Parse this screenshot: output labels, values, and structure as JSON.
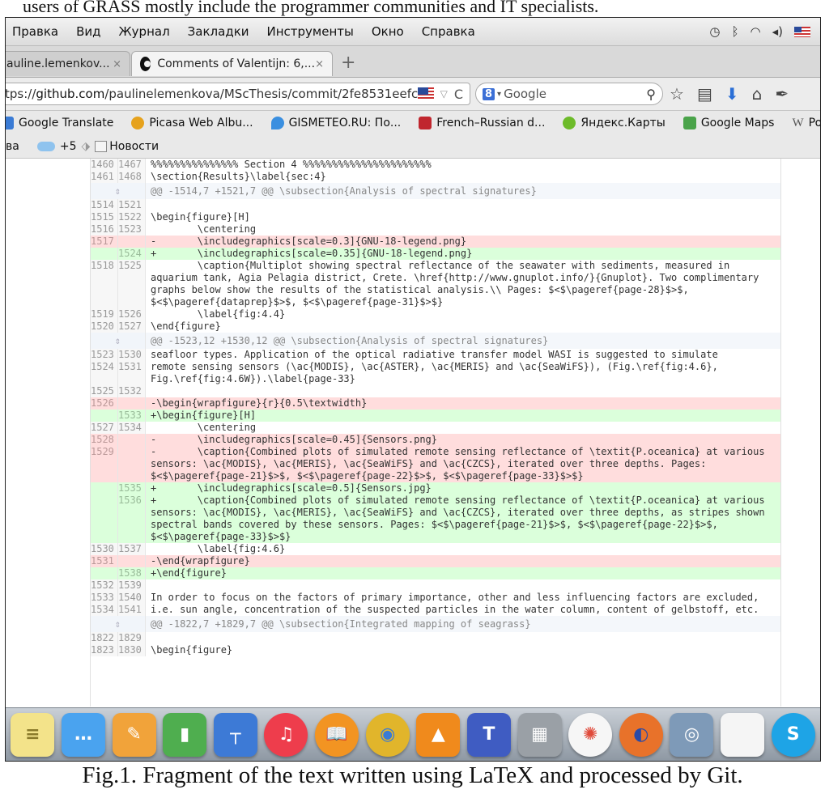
{
  "top_text": "users of GRASS mostly include the programmer communities and IT specialists.",
  "menu": {
    "items": [
      "Правка",
      "Вид",
      "Журнал",
      "Закладки",
      "Инструменты",
      "Окно",
      "Справка"
    ]
  },
  "tabs": [
    {
      "label": "auline.lemenkov...",
      "close": "×"
    },
    {
      "label": "Comments of Valentijn: 6,...",
      "close": "×"
    }
  ],
  "newtab": "+",
  "url": {
    "prefix": "tps://",
    "host": "github.com",
    "path": "/paulinelemenkova/MScThesis/commit/2fe8531eefc"
  },
  "search": {
    "engine_badge": "8",
    "placeholder": "Google"
  },
  "bookmarks": [
    {
      "label": "Google Translate",
      "color": "#3a7bd5"
    },
    {
      "label": "Picasa Web Albu...",
      "color": "#e6a21d"
    },
    {
      "label": "GISMETEO.RU: По...",
      "color": "#3a8fe0"
    },
    {
      "label": "French–Russian d...",
      "color": "#c0262e"
    },
    {
      "label": "Яндекс.Карты",
      "color": "#6dbb2a"
    },
    {
      "label": "Google Maps",
      "color": "#4aa34a"
    },
    {
      "label": "Portal:Content",
      "color": "#777777"
    }
  ],
  "bookmarks2": {
    "first": "ва",
    "count": "+5",
    "news": "Новости"
  },
  "diff": {
    "rows": [
      {
        "t": "ctx",
        "o": "1460",
        "n": "1467",
        "c": "%%%%%%%%%%%%%%% Section 4 %%%%%%%%%%%%%%%%%%%%%%"
      },
      {
        "t": "ctx",
        "o": "1461",
        "n": "1468",
        "c": "\\section{Results}\\label{sec:4}"
      },
      {
        "t": "hunk",
        "c": "@@ -1514,7 +1521,7 @@ \\subsection{Analysis of spectral signatures}"
      },
      {
        "t": "ctx",
        "o": "1514",
        "n": "1521",
        "c": ""
      },
      {
        "t": "ctx",
        "o": "1515",
        "n": "1522",
        "c": "\\begin{figure}[H]"
      },
      {
        "t": "ctx",
        "o": "1516",
        "n": "1523",
        "c": "        \\centering"
      },
      {
        "t": "del",
        "o": "1517",
        "n": "",
        "c": "-       \\includegraphics[scale=0.3]{GNU-18-legend.png}"
      },
      {
        "t": "add",
        "o": "",
        "n": "1524",
        "c": "+       \\includegraphics[scale=0.35]{GNU-18-legend.png}"
      },
      {
        "t": "ctx",
        "o": "1518",
        "n": "1525",
        "c": "        \\caption{Multiplot showing spectral reflectance of the seawater with sediments, measured in aquarium tank, Agia Pelagia district, Crete. \\href{http://www.gnuplot.info/}{Gnuplot}. Two complimentary graphs below show the results of the statistical analysis.\\\\ Pages: $<$\\pageref{page-28}$>$, $<$\\pageref{dataprep}$>$, $<$\\pageref{page-31}$>$}"
      },
      {
        "t": "ctx",
        "o": "1519",
        "n": "1526",
        "c": "        \\label{fig:4.4}"
      },
      {
        "t": "ctx",
        "o": "1520",
        "n": "1527",
        "c": "\\end{figure}"
      },
      {
        "t": "hunk",
        "c": "@@ -1523,12 +1530,12 @@ \\subsection{Analysis of spectral signatures}"
      },
      {
        "t": "ctx",
        "o": "1523",
        "n": "1530",
        "c": "seafloor types. Application of the optical radiative transfer model WASI is suggested to simulate"
      },
      {
        "t": "ctx",
        "o": "1524",
        "n": "1531",
        "c": "remote sensing sensors (\\ac{MODIS}, \\ac{ASTER}, \\ac{MERIS} and \\ac{SeaWiFS}), (Fig.\\ref{fig:4.6}, Fig.\\ref{fig:4.6W}).\\label{page-33}"
      },
      {
        "t": "ctx",
        "o": "1525",
        "n": "1532",
        "c": ""
      },
      {
        "t": "del",
        "o": "1526",
        "n": "",
        "c": "-\\begin{wrapfigure}{r}{0.5\\textwidth}"
      },
      {
        "t": "add",
        "o": "",
        "n": "1533",
        "c": "+\\begin{figure}[H]"
      },
      {
        "t": "ctx",
        "o": "1527",
        "n": "1534",
        "c": "        \\centering"
      },
      {
        "t": "del",
        "o": "1528",
        "n": "",
        "c": "-       \\includegraphics[scale=0.45]{Sensors.png}"
      },
      {
        "t": "del",
        "o": "1529",
        "n": "",
        "c": "-       \\caption{Combined plots of simulated remote sensing reflectance of \\textit{P.oceanica} at various sensors: \\ac{MODIS}, \\ac{MERIS}, \\ac{SeaWiFS} and \\ac{CZCS}, iterated over three depths. Pages: $<$\\pageref{page-21}$>$, $<$\\pageref{page-22}$>$, $<$\\pageref{page-33}$>$}"
      },
      {
        "t": "add",
        "o": "",
        "n": "1535",
        "c": "+       \\includegraphics[scale=0.5]{Sensors.jpg}"
      },
      {
        "t": "add",
        "o": "",
        "n": "1536",
        "c": "+       \\caption{Combined plots of simulated remote sensing reflectance of \\textit{P.oceanica} at various sensors: \\ac{MODIS}, \\ac{MERIS}, \\ac{SeaWiFS} and \\ac{CZCS}, iterated over three depths, as stripes shown spectral bands covered by these sensors. Pages: $<$\\pageref{page-21}$>$, $<$\\pageref{page-22}$>$, $<$\\pageref{page-33}$>$}"
      },
      {
        "t": "ctx",
        "o": "1530",
        "n": "1537",
        "c": "        \\label{fig:4.6}"
      },
      {
        "t": "del",
        "o": "1531",
        "n": "",
        "c": "-\\end{wrapfigure}"
      },
      {
        "t": "add",
        "o": "",
        "n": "1538",
        "c": "+\\end{figure}"
      },
      {
        "t": "ctx",
        "o": "1532",
        "n": "1539",
        "c": ""
      },
      {
        "t": "ctx",
        "o": "1533",
        "n": "1540",
        "c": "In order to focus on the factors of primary importance, other and less influencing factors are excluded,"
      },
      {
        "t": "ctx",
        "o": "1534",
        "n": "1541",
        "c": "i.e. sun angle, concentration of the suspected particles in the water column, content of gelbstoff, etc."
      },
      {
        "t": "hunk",
        "c": "@@ -1822,7 +1829,7 @@ \\subsection{Integrated mapping of seagrass}"
      },
      {
        "t": "ctx",
        "o": "1822",
        "n": "1829",
        "c": ""
      },
      {
        "t": "ctx",
        "o": "1823",
        "n": "1830",
        "c": "\\begin{figure}"
      }
    ]
  },
  "dock": [
    {
      "name": "stickies-icon",
      "bg": "#f3e38a",
      "glyph": "≡",
      "fg": "#8a7a2a"
    },
    {
      "name": "messages-icon",
      "bg": "#4aa3ef",
      "glyph": "…",
      "fg": "#ffffff"
    },
    {
      "name": "pages-icon",
      "bg": "#f1a33a",
      "glyph": "✎",
      "fg": "#ffffff"
    },
    {
      "name": "numbers-icon",
      "bg": "#4fae4f",
      "glyph": "▮",
      "fg": "#ffffff"
    },
    {
      "name": "keynote-icon",
      "bg": "#3d7ad6",
      "glyph": "┬",
      "fg": "#ffffff"
    },
    {
      "name": "itunes-icon",
      "bg": "#ee3d4c",
      "glyph": "♫",
      "fg": "#ffffff"
    },
    {
      "name": "ibooks-icon",
      "bg": "#f29422",
      "glyph": "📖",
      "fg": "#ffffff"
    },
    {
      "name": "chrome-icon",
      "bg": "#e1b52b",
      "glyph": "◉",
      "fg": "#3a7bd5"
    },
    {
      "name": "vlc-icon",
      "bg": "#f08a1c",
      "glyph": "▲",
      "fg": "#ffffff"
    },
    {
      "name": "texshop-icon",
      "bg": "#3f5cc2",
      "glyph": "T",
      "fg": "#ffffff"
    },
    {
      "name": "calculator-icon",
      "bg": "#9aa0a6",
      "glyph": "▦",
      "fg": "#ffffff"
    },
    {
      "name": "picasa-icon",
      "bg": "#f6f6f6",
      "glyph": "✺",
      "fg": "#e04a3a"
    },
    {
      "name": "firefox-icon",
      "bg": "#e8722a",
      "glyph": "◐",
      "fg": "#2a4aa8"
    },
    {
      "name": "preview-icon",
      "bg": "#7e9ab8",
      "glyph": "◎",
      "fg": "#ffffff"
    },
    {
      "name": "document-icon",
      "bg": "#f5f5f5",
      "glyph": " ",
      "fg": "#ffffff"
    },
    {
      "name": "skype-icon",
      "bg": "#1ea4e6",
      "glyph": "S",
      "fg": "#ffffff"
    }
  ],
  "caption": "Fig.1. Fragment of the text written using LaTeX and processed by Git."
}
